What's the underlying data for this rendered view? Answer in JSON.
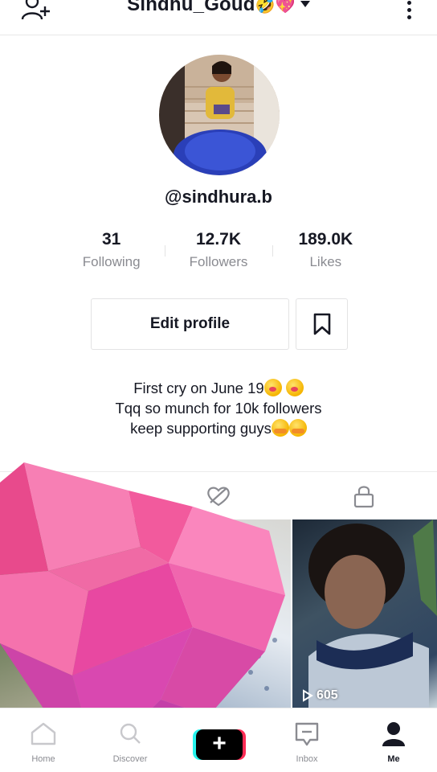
{
  "header": {
    "title": "Sindhu_Goud",
    "title_emojis": "🤣💖",
    "add_user_icon": "add-user-icon",
    "more_icon": "more-vertical-icon"
  },
  "profile": {
    "username": "@sindhura.b",
    "stats": [
      {
        "value": "31",
        "label": "Following"
      },
      {
        "value": "12.7K",
        "label": "Followers"
      },
      {
        "value": "189.0K",
        "label": "Likes"
      }
    ],
    "edit_button_label": "Edit profile",
    "bio_lines": [
      "First cry on June 19",
      "Tqq so munch for 10k followers",
      "keep supporting guys"
    ]
  },
  "tabs": [
    {
      "icon": "videos-grid-icon"
    },
    {
      "icon": "liked-heart-icon"
    },
    {
      "icon": "lock-icon"
    }
  ],
  "videos": [
    {
      "views": ""
    },
    {
      "views": ""
    },
    {
      "views": "605"
    }
  ],
  "bottom_nav": [
    {
      "label": "Home",
      "icon": "home-icon"
    },
    {
      "label": "Discover",
      "icon": "search-icon"
    },
    {
      "label": "",
      "icon": "create-plus-icon"
    },
    {
      "label": "Inbox",
      "icon": "inbox-icon"
    },
    {
      "label": "Me",
      "icon": "profile-icon"
    }
  ],
  "colors": {
    "accent_red": "#fe2c55",
    "accent_cyan": "#25f4ee",
    "secondary_text": "#8a8b91",
    "heart_pink": "#f0559a"
  }
}
